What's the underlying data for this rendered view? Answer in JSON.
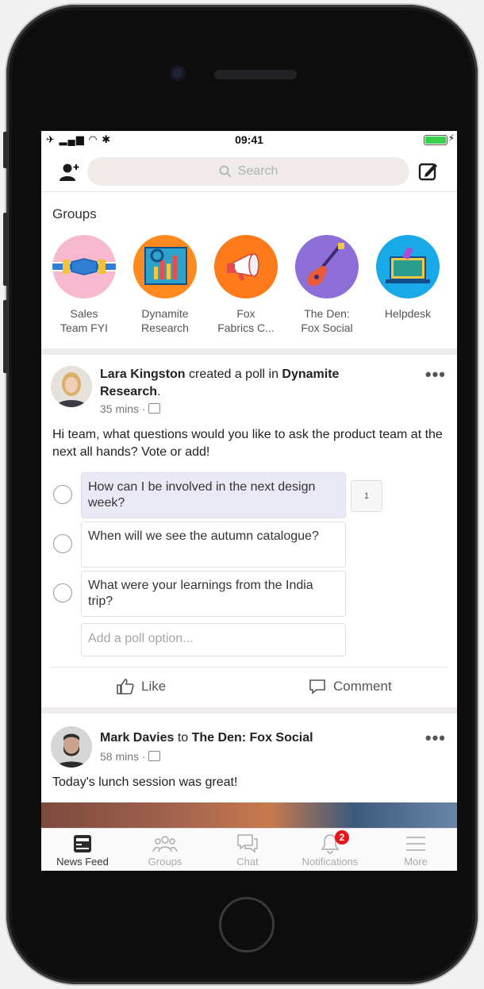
{
  "status_bar": {
    "time": "09:41"
  },
  "top_bar": {
    "search_placeholder": "Search"
  },
  "groups": {
    "title": "Groups",
    "items": [
      {
        "label": "Sales Team FYI",
        "line1": "Sales",
        "line2": "Team FYI",
        "color": "#f7b9cf",
        "icon": "handshake-icon"
      },
      {
        "label": "Dynamite Research",
        "line1": "Dynamite",
        "line2": "Research",
        "color": "#ff8a1f",
        "icon": "bar-chart-icon"
      },
      {
        "label": "Fox Fabrics C...",
        "line1": "Fox",
        "line2": "Fabrics C...",
        "color": "#ff7a1a",
        "icon": "megaphone-icon"
      },
      {
        "label": "The Den: Fox Social",
        "line1": "The Den:",
        "line2": "Fox Social",
        "color": "#8e6fd8",
        "icon": "guitar-icon"
      },
      {
        "label": "Helpdesk",
        "line1": "Helpdesk",
        "line2": "",
        "color": "#19a8e8",
        "icon": "laptop-icon"
      }
    ]
  },
  "posts": [
    {
      "author": "Lara Kingston",
      "action": " created a poll in ",
      "target": "Dynamite Research",
      "target_suffix": ".",
      "time": "35 mins",
      "text": "Hi team, what questions would you like to ask the product team at the next all hands? Vote or add!",
      "poll_options": [
        {
          "text": "How can I be involved in the next design week?",
          "votes": "1",
          "selected": true
        },
        {
          "text": "When will we see the autumn catalogue?",
          "votes": "",
          "selected": false
        },
        {
          "text": "What were your learnings from the India trip?",
          "votes": "",
          "selected": false
        }
      ],
      "add_option_placeholder": "Add a poll option...",
      "like_label": "Like",
      "comment_label": "Comment"
    },
    {
      "author": "Mark Davies",
      "action": " to ",
      "target": "The Den: Fox Social",
      "time": "58 mins",
      "text": "Today's lunch session was great!"
    }
  ],
  "tab_bar": {
    "tabs": [
      {
        "label": "News Feed",
        "icon": "news-feed-icon",
        "active": true
      },
      {
        "label": "Groups",
        "icon": "groups-icon",
        "active": false
      },
      {
        "label": "Chat",
        "icon": "chat-icon",
        "active": false
      },
      {
        "label": "Notifications",
        "icon": "bell-icon",
        "active": false,
        "badge": "2"
      },
      {
        "label": "More",
        "icon": "menu-icon",
        "active": false
      }
    ]
  },
  "colors": {
    "accent": "#3b5998",
    "badge": "#e8141a"
  }
}
